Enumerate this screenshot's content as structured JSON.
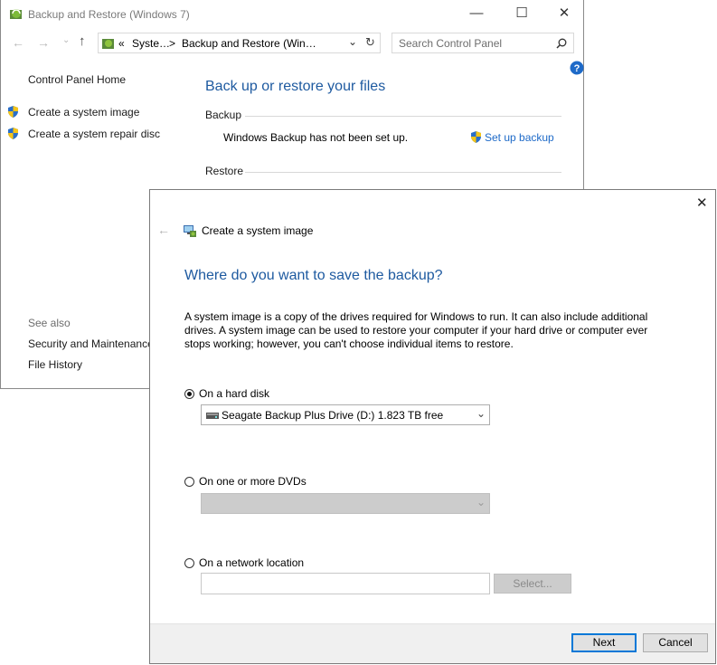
{
  "bg_window": {
    "title": "Backup and Restore (Windows 7)",
    "address_parts": [
      "«",
      "Syste…",
      ">",
      "Backup and Restore (Win…"
    ],
    "search_placeholder": "Search Control Panel",
    "sidebar": {
      "home": "Control Panel Home",
      "items": [
        "Create a system image",
        "Create a system repair disc"
      ],
      "see_also_header": "See also",
      "see_also": [
        "Security and Maintenance",
        "File History"
      ]
    },
    "main": {
      "heading": "Back up or restore your files",
      "backup_header": "Backup",
      "backup_status": "Windows Backup has not been set up.",
      "setup_link": "Set up backup",
      "restore_header": "Restore"
    }
  },
  "dialog": {
    "title": "Create a system image",
    "heading": "Where do you want to save the backup?",
    "description": [
      "A system image is a copy of the drives required for Windows to run. It can also include additional",
      "drives. A system image can be used to restore your computer if your hard drive or computer ever",
      "stops working; however, you can't choose individual items to restore."
    ],
    "options": {
      "hard_disk": {
        "label": "On a hard disk",
        "selected": true,
        "value": "Seagate Backup Plus Drive (D:)  1.823 TB free"
      },
      "dvds": {
        "label": "On one or more DVDs",
        "selected": false,
        "value": ""
      },
      "network": {
        "label": "On a network location",
        "selected": false,
        "value": "",
        "select_label": "Select..."
      }
    },
    "buttons": {
      "next": "Next",
      "cancel": "Cancel"
    }
  },
  "colors": {
    "accent": "#0078d7",
    "heading_blue": "#1e5aa0",
    "link_blue": "#1e6ac8"
  }
}
